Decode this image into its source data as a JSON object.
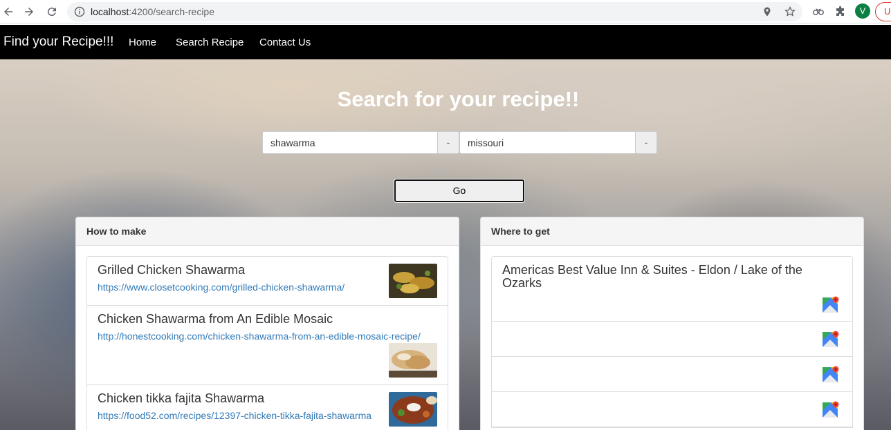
{
  "browser": {
    "url_host": "localhost",
    "url_path": ":4200/search-recipe",
    "profile_initial": "V",
    "update_label": "Up"
  },
  "navbar": {
    "brand": "Find your Recipe!!!",
    "links": [
      "Home",
      "Search Recipe",
      "Contact Us"
    ]
  },
  "hero": {
    "title": "Search for your recipe!!",
    "recipe_input": "shawarma",
    "location_input": "missouri",
    "addon_symbol": "-",
    "go_label": "Go"
  },
  "how_to_make": {
    "heading": "How to make",
    "items": [
      {
        "title": "Grilled Chicken Shawarma",
        "link": "https://www.closetcooking.com/grilled-chicken-shawarma/"
      },
      {
        "title": "Chicken Shawarma from An Edible Mosaic",
        "link": "http://honestcooking.com/chicken-shawarma-from-an-edible-mosaic-recipe/"
      },
      {
        "title": "Chicken tikka fajita Shawarma",
        "link": "https://food52.com/recipes/12397-chicken-tikka-fajita-shawarma"
      }
    ]
  },
  "where_to_get": {
    "heading": "Where to get",
    "items": [
      {
        "title": "Americas Best Value Inn & Suites - Eldon / Lake of the Ozarks"
      },
      {
        "title": ""
      },
      {
        "title": ""
      },
      {
        "title": ""
      }
    ]
  },
  "colors": {
    "navbar_bg": "#000000",
    "link_blue": "#337ab7",
    "panel_heading_bg": "#f5f5f5"
  }
}
